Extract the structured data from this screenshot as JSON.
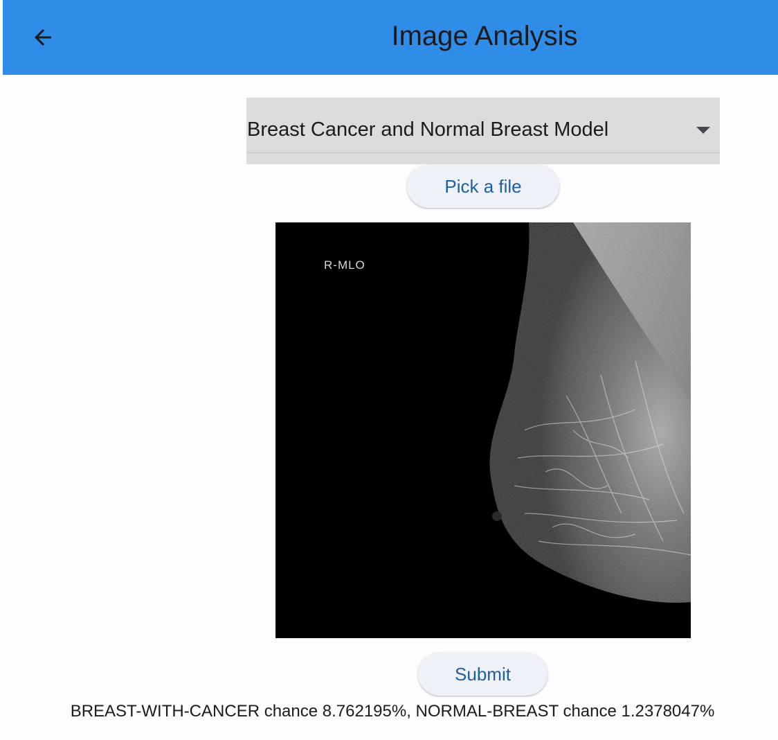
{
  "app_bar": {
    "title": "Image Analysis",
    "back_icon": "arrow-left-icon",
    "background_color": "#2f8de8"
  },
  "model_select": {
    "selected": "Breast Cancer and Normal Breast Model",
    "dropdown_icon": "caret-down-icon"
  },
  "pick_file_button": {
    "label": "Pick a file"
  },
  "preview_image": {
    "overlay_text": "R-MLO"
  },
  "submit_button": {
    "label": "Submit"
  },
  "result": {
    "text": "BREAST-WITH-CANCER chance 8.762195%, NORMAL-BREAST chance 1.2378047%"
  },
  "colors": {
    "accent_text": "#1c5fa3",
    "page_background": "#fdfcff",
    "dropdown_fill": "#dcdcdf"
  }
}
